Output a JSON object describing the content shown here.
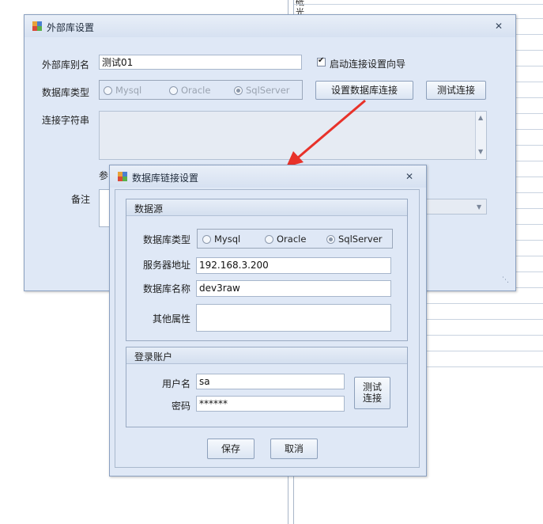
{
  "background": {
    "glyph_1": "砥",
    "glyph_2": "光"
  },
  "main_window": {
    "title": "外部库设置",
    "alias_label": "外部库别名",
    "alias_value": "测试01",
    "wizard_checkbox_label": "启动连接设置向导",
    "db_type_label": "数据库类型",
    "db_types": [
      "Mysql",
      "Oracle",
      "SqlServer"
    ],
    "setup_button": "设置数据库连接",
    "test_button": "测试连接",
    "conn_string_label": "连接字符串",
    "conn_string_value": "",
    "param_label_partial": "参",
    "remark_label": "备注"
  },
  "dialog": {
    "title": "数据库链接设置",
    "datasource_group": "数据源",
    "db_type_label": "数据库类型",
    "db_types": [
      "Mysql",
      "Oracle",
      "SqlServer"
    ],
    "server_label": "服务器地址",
    "server_value": "192.168.3.200",
    "dbname_label": "数据库名称",
    "dbname_value": "dev3raw",
    "other_label": "其他属性",
    "other_value": "",
    "account_group": "登录账户",
    "username_label": "用户名",
    "username_value": "sa",
    "password_label": "密码",
    "password_value": "******",
    "test_button_line1": "测试",
    "test_button_line2": "连接",
    "save_button": "保存",
    "cancel_button": "取消"
  },
  "colors": {
    "window_bg": "#dfe8f6",
    "border": "#8aa0c0",
    "arrow": "#e8322a"
  }
}
